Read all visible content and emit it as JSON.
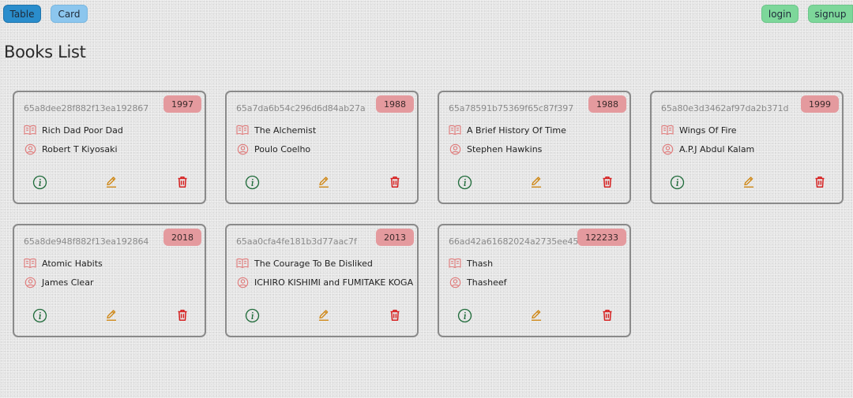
{
  "toolbar": {
    "table_label": "Table",
    "card_label": "Card",
    "login_label": "login",
    "signup_label": "signup"
  },
  "page_title": "Books List",
  "colors": {
    "accent_table": "#2a8dcc",
    "accent_card": "#8cc6ee",
    "auth_green": "#7dd79a",
    "badge_red": "#e49a9e",
    "icon_red": "#e07a7a",
    "info_green": "#1f6b3a",
    "edit_orange": "#d08a1a",
    "delete_red": "#d62020"
  },
  "icons": {
    "title": "book-open-icon",
    "author": "user-circle-icon",
    "info": "info-circle-icon",
    "edit": "pencil-icon",
    "delete": "trash-icon"
  },
  "books": [
    {
      "id": "65a8dee28f882f13ea192867",
      "year": "1997",
      "title": "Rich Dad Poor Dad",
      "author": "Robert T Kiyosaki"
    },
    {
      "id": "65a7da6b54c296d6d84ab27a",
      "year": "1988",
      "title": "The Alchemist",
      "author": "Poulo Coelho"
    },
    {
      "id": "65a78591b75369f65c87f397",
      "year": "1988",
      "title": "A Brief History Of Time",
      "author": "Stephen Hawkins"
    },
    {
      "id": "65a80e3d3462af97da2b371d",
      "year": "1999",
      "title": "Wings Of Fire",
      "author": "A.P.J Abdul Kalam"
    },
    {
      "id": "65a8de948f882f13ea192864",
      "year": "2018",
      "title": "Atomic Habits",
      "author": "James Clear"
    },
    {
      "id": "65aa0cfa4fe181b3d77aac7f",
      "year": "2013",
      "title": "The Courage To Be Disliked",
      "author": "ICHIRO KISHIMI and FUMITAKE KOGA"
    },
    {
      "id": "66ad42a61682024a2735ee45",
      "year": "122233",
      "title": "Thash",
      "author": "Thasheef"
    }
  ]
}
